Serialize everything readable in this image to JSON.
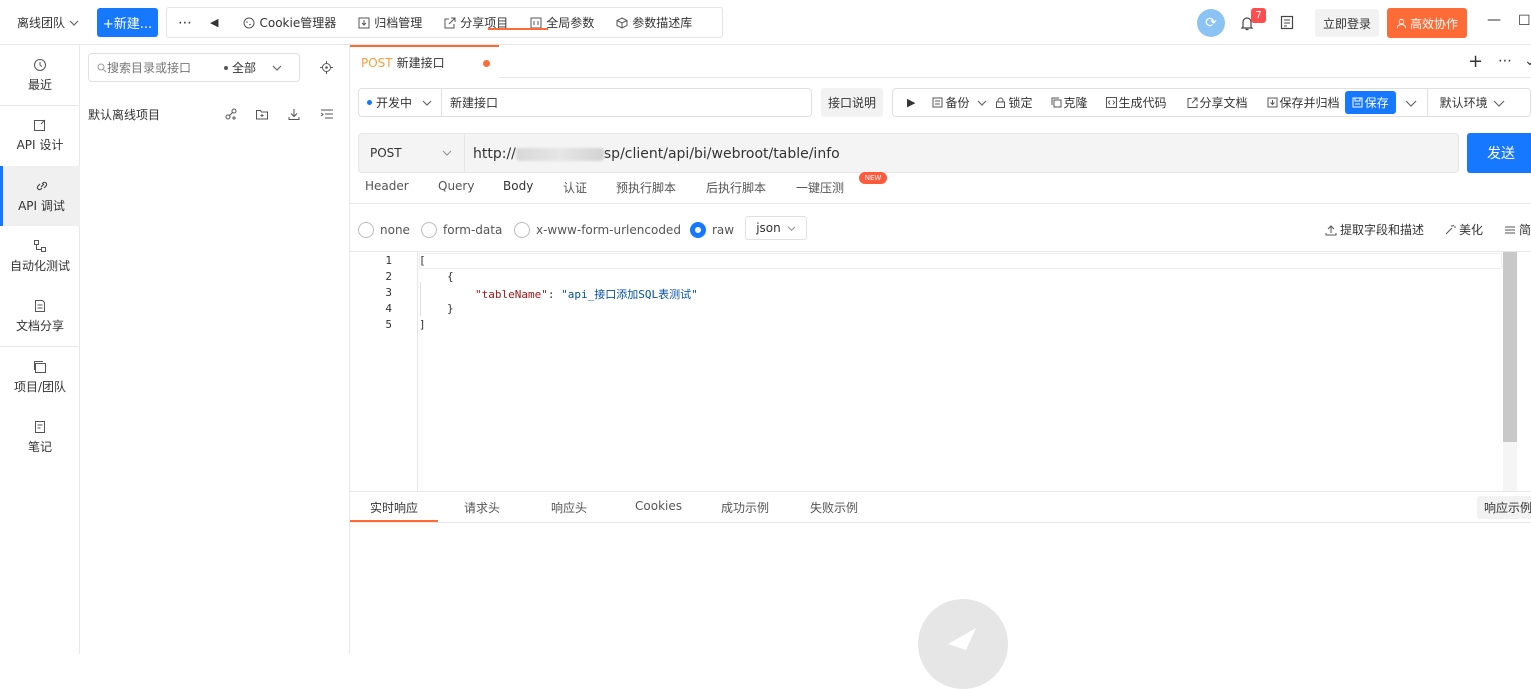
{
  "topbar": {
    "team": "离线团队",
    "new_button": "+新建...",
    "tools": [
      {
        "label": "Cookie管理器",
        "icon": "cookie-icon"
      },
      {
        "label": "归档管理",
        "icon": "archive-icon"
      },
      {
        "label": "分享项目",
        "icon": "share-icon"
      },
      {
        "label": "全局参数",
        "icon": "params-icon"
      },
      {
        "label": "参数描述库",
        "icon": "cube-icon"
      }
    ],
    "notify_count": "7",
    "login": "立即登录",
    "collab": "高效协作"
  },
  "leftnav": [
    {
      "label": "最近",
      "icon": "history-icon"
    },
    {
      "label": "API 设计",
      "icon": "edit-icon"
    },
    {
      "label": "API 调试",
      "icon": "link-icon",
      "active": true
    },
    {
      "label": "自动化测试",
      "icon": "flow-icon"
    },
    {
      "label": "文档分享",
      "icon": "doc-icon"
    },
    {
      "label": "项目/团队",
      "icon": "project-icon"
    },
    {
      "label": "笔记",
      "icon": "note-icon"
    }
  ],
  "tree": {
    "search_placeholder": "搜索目录或接口",
    "filter": "全部",
    "project": "默认离线项目"
  },
  "tab": {
    "method": "POST",
    "name": "新建接口"
  },
  "request": {
    "status": "开发中",
    "name": "新建接口",
    "desc_button": "接口说明",
    "actions": {
      "backup": "备份",
      "lock": "锁定",
      "clone": "克隆",
      "gen_code": "生成代码",
      "share_doc": "分享文档",
      "save_archive": "保存并归档",
      "save": "保存",
      "env": "默认环境"
    },
    "method": "POST",
    "url_prefix": "http://",
    "url_suffix": "sp/client/api/bi/webroot/table/info",
    "send": "发送"
  },
  "req_tabs": [
    "Header",
    "Query",
    "Body",
    "认证",
    "预执行脚本",
    "后执行脚本",
    "一键压测"
  ],
  "new_tag": "NEW",
  "body": {
    "types": [
      "none",
      "form-data",
      "x-www-form-urlencoded",
      "raw"
    ],
    "selected": "raw",
    "format": "json",
    "extract": "提取字段和描述",
    "beautify": "美化",
    "simple": "简"
  },
  "editor": {
    "lines": [
      "1",
      "2",
      "3",
      "4",
      "5"
    ],
    "l1": "[",
    "l2": "{",
    "l3_key": "\"tableName\"",
    "l3_colon": ": ",
    "l3_val": "\"api_接口添加SQL表测试\"",
    "l4": "}",
    "l5": "]"
  },
  "resp_tabs": [
    "实时响应",
    "请求头",
    "响应头",
    "Cookies",
    "成功示例",
    "失败示例"
  ],
  "resp_right": "响应示例"
}
